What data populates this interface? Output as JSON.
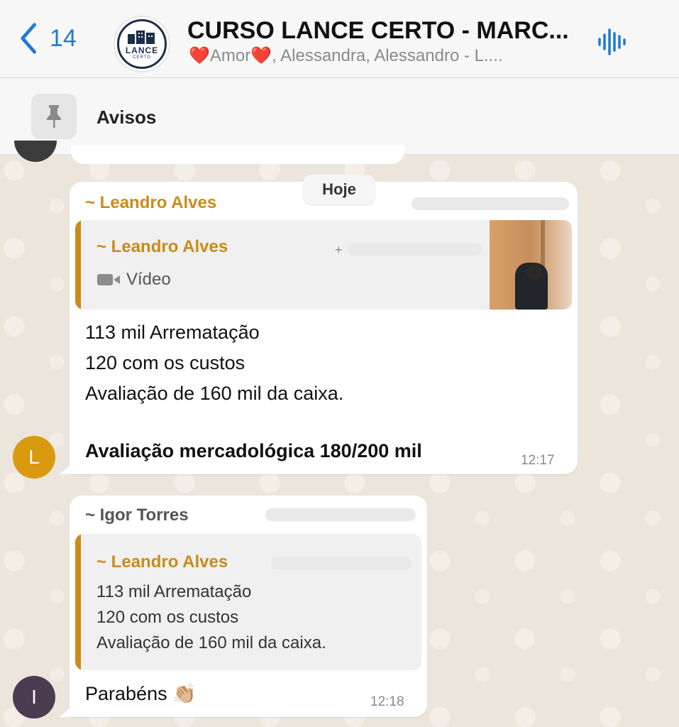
{
  "header": {
    "back_count": "14",
    "logo_text": "LANCE",
    "logo_subtext": "CERTO",
    "title": "CURSO LANCE CERTO - MARC...",
    "subtitle_heart_left": "❤️",
    "subtitle_amor": "Amor",
    "subtitle_heart_right": "❤️",
    "subtitle_rest": ", Alessandra, Alessandro - L...."
  },
  "pinned": {
    "label": "Avisos",
    "icon": "pin-icon"
  },
  "date_chip": "Hoje",
  "messages": [
    {
      "sender": "~ Leandro Alves",
      "avatar_letter": "L",
      "avatar_color": "#d99a10",
      "quoted": {
        "sender": "~ Leandro Alves",
        "phone_prefix": "+",
        "media_label": "Vídeo",
        "media_icon": "video-camera-icon"
      },
      "lines": [
        "113 mil Arrematação",
        "120 com os custos",
        "Avaliação de 160 mil da caixa."
      ],
      "bold_line": "Avaliação mercadológica 180/200 mil",
      "time": "12:17"
    },
    {
      "sender": "~ Igor Torres",
      "avatar_letter": "I",
      "avatar_color": "#4a3d52",
      "quoted": {
        "sender": "~ Leandro Alves",
        "lines": [
          "113 mil Arrematação",
          "120 com os custos",
          "Avaliação de 160 mil da caixa."
        ]
      },
      "text": "Parabéns",
      "emoji": "👏🏼",
      "time": "12:18"
    }
  ],
  "colors": {
    "accent_blue": "#1f7ad1",
    "sender_orange": "#c98b1a",
    "chat_background": "#ece5dc"
  }
}
